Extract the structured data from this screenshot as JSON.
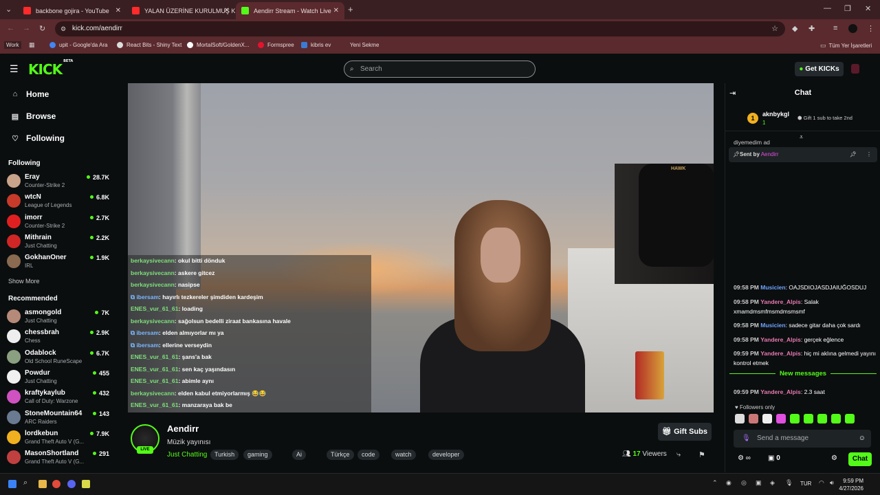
{
  "browser": {
    "tabs": [
      {
        "label": "backbone gojira - YouTube",
        "color": "#ff2b2b"
      },
      {
        "label": "YALAN ÜZERİNE KURULMUŞ K",
        "color": "#ff2b2b"
      },
      {
        "label": "Aendirr Stream - Watch Live",
        "color": "#53fc18"
      }
    ],
    "url": "kick.com/aendirr",
    "bookmarks": [
      "Work",
      "upit - Google'da Ara",
      "React Bits - Shiny Text",
      "MortalSoft/GoldenX...",
      "Formspree",
      "kibris ev",
      "Yeni Sekme",
      "Tüm Yer İşaretleri"
    ]
  },
  "header": {
    "logo": "KICK",
    "beta": "BETA",
    "search_placeholder": "Search",
    "get_kicks": "Get KICKs"
  },
  "sidebar": {
    "nav": [
      "Home",
      "Browse",
      "Following"
    ],
    "following_title": "Following",
    "following": [
      {
        "name": "Eray",
        "cat": "Counter-Strike 2",
        "viewers": "28.7K",
        "color": "#c9a38a"
      },
      {
        "name": "wtcN",
        "cat": "League of Legends",
        "viewers": "6.8K",
        "color": "#c83a2a"
      },
      {
        "name": "imorr",
        "cat": "Counter-Strike 2",
        "viewers": "2.7K",
        "color": "#e02020"
      },
      {
        "name": "Mithrain",
        "cat": "Just Chatting",
        "viewers": "2.2K",
        "color": "#d02626"
      },
      {
        "name": "GokhanOner",
        "cat": "IRL",
        "viewers": "1.9K",
        "color": "#8a6a50"
      }
    ],
    "show_more": "Show More",
    "recommended_title": "Recommended",
    "recommended": [
      {
        "name": "asmongold",
        "cat": "Just Chatting",
        "viewers": "7K",
        "color": "#b58a78"
      },
      {
        "name": "chessbrah",
        "cat": "Chess",
        "viewers": "2.9K",
        "color": "#eeeeee"
      },
      {
        "name": "Odablock",
        "cat": "Old School RuneScape",
        "viewers": "6.7K",
        "color": "#8aa080"
      },
      {
        "name": "Powdur",
        "cat": "Just Chatting",
        "viewers": "455",
        "color": "#f0f0f0"
      },
      {
        "name": "kraftykaylub",
        "cat": "Call of Duty: Warzone",
        "viewers": "432",
        "color": "#cf52c0"
      },
      {
        "name": "StoneMountain64",
        "cat": "ARC Raiders",
        "viewers": "143",
        "color": "#6a7a90"
      },
      {
        "name": "lordkebun",
        "cat": "Grand Theft Auto V (G...",
        "viewers": "7.9K",
        "color": "#f0b020"
      },
      {
        "name": "MasonShortland",
        "cat": "Grand Theft Auto V (G...",
        "viewers": "291",
        "color": "#c04040"
      }
    ]
  },
  "overlay_chat": [
    {
      "user": "berkaysivecann",
      "msg": ": okul bitti dönduk",
      "blue": false
    },
    {
      "user": "berkaysivecann",
      "msg": ": askere gitcez",
      "blue": false
    },
    {
      "user": "berkaysivecann",
      "msg": ": nasipse",
      "blue": false
    },
    {
      "user": "ibersam",
      "msg": ": hayırlı tezkereler şimdiden kardeşim",
      "blue": true
    },
    {
      "user": "ENES_vur_61_61",
      "msg": ": loading",
      "blue": false
    },
    {
      "user": "berkaysivecann",
      "msg": ": sağolsun bedelli ziraat bankasına havale",
      "blue": false
    },
    {
      "user": "ibersam",
      "msg": ": elden almıyorlar mı ya",
      "blue": true
    },
    {
      "user": "ibersam",
      "msg": ": ellerine verseydin",
      "blue": true
    },
    {
      "user": "ENES_vur_61_61",
      "msg": ": şans'a bak",
      "blue": false
    },
    {
      "user": "ENES_vur_61_61",
      "msg": ": sen kaç yaşındasın",
      "blue": false
    },
    {
      "user": "ENES_vur_61_61",
      "msg": ": abimle aynı",
      "blue": false
    },
    {
      "user": "berkaysivecann",
      "msg": ": elden kabul etmiyorlarmış 😂😂",
      "blue": false
    },
    {
      "user": "ENES_vur_61_61",
      "msg": ": manzaraya bak be",
      "blue": false
    }
  ],
  "stream": {
    "channel": "Aendirr",
    "title": "Müzik yayınısı",
    "category": "Just Chatting",
    "tags": [
      "Turkish",
      "gaming",
      "Ai",
      "Türkçe",
      "code",
      "watch",
      "developer"
    ],
    "live": "LIVE",
    "viewers": "17",
    "viewers_label": "Viewers",
    "gift_subs": "Gift Subs"
  },
  "chat": {
    "title": "Chat",
    "top_gifter": {
      "rank": "1",
      "name": "aknbykgl",
      "count": "1",
      "gift_text": "Gift 1 sub to take 2nd"
    },
    "partial_text": "diyemedim ad",
    "pinned": {
      "sent_by": "Sent by",
      "user": "Aendirr"
    },
    "messages": [
      {
        "time": "09:58 PM",
        "user": "Musicien",
        "msg": "OAJSDIOJASDJAIUĞOSDUJ",
        "blue": true
      },
      {
        "time": "09:58 PM",
        "user": "Yandere_Alpis",
        "msg": "Salak xmamdmsmfmsmdmsmsmf",
        "blue": false
      },
      {
        "time": "09:58 PM",
        "user": "Musicien",
        "msg": "sadece gitar daha çok sardı",
        "blue": true
      },
      {
        "time": "09:58 PM",
        "user": "Yandere_Alpis",
        "msg": "gerçek eğlence",
        "blue": false
      },
      {
        "time": "09:59 PM",
        "user": "Yandere_Alpis",
        "msg": "hiç mi aklına gelmedi yayını kontrol etmek",
        "blue": false
      }
    ],
    "new_messages": "New messages",
    "last": {
      "time": "09:59 PM",
      "user": "Yandere_Alpis",
      "msg": "2.3 saat"
    },
    "followers_only": "Followers only",
    "placeholder": "Send a message",
    "points": "0",
    "send": "Chat"
  },
  "taskbar": {
    "lang": "TUR",
    "time": "9:59 PM",
    "date": "4/27/2026"
  }
}
